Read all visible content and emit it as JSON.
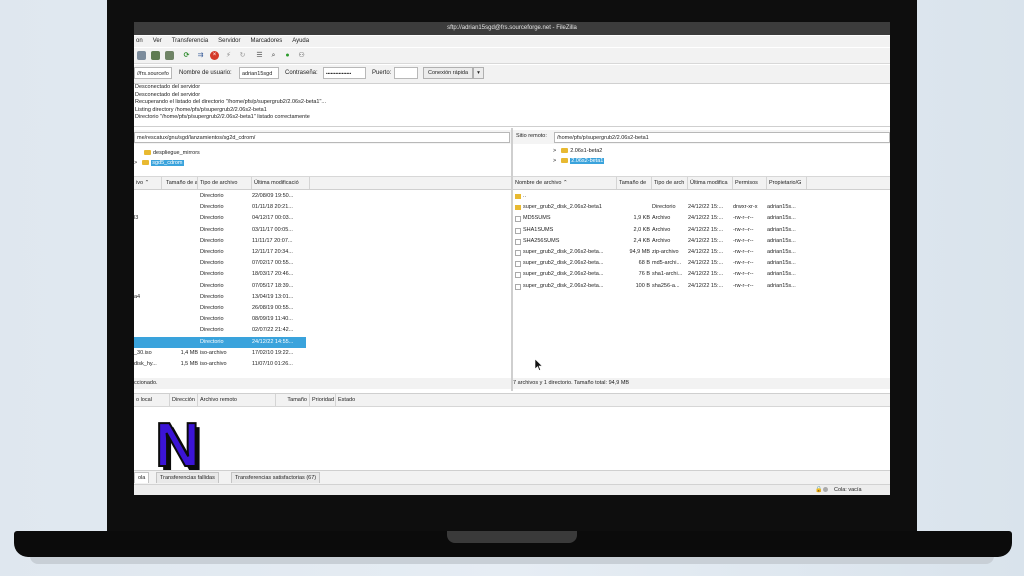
{
  "window": {
    "title": "sftp://adrian15sgd@frs.sourceforge.net - FileZilla"
  },
  "menu": [
    "on",
    "Ver",
    "Transferencia",
    "Servidor",
    "Marcadores",
    "Ayuda"
  ],
  "quickconnect": {
    "host_value": "//frs.sourcefo",
    "user_label": "Nombre de usuario:",
    "user_value": "adrian15sgd",
    "password_label": "Contraseña:",
    "password_value": "••••••••••••••••",
    "port_label": "Puerto:",
    "port_value": "",
    "connect_label": "Conexión rápida",
    "dropdown_icon": "chevron-down"
  },
  "log": [
    "Desconectado del servidor",
    "Desconectado del servidor",
    "Recuperando el listado del directorio \"/home/pfs/p/supergrub2/2.06s2-beta1\"...",
    "Listing directory /home/pfs/p/supergrub2/2.06s2-beta1",
    "Directorio \"/home/pfs/p/supergrub2/2.06s2-beta1\" listado correctamente"
  ],
  "local": {
    "path": "me/rescatux/gnu/sgd/lanzamientos/sg2d_cdrom/",
    "tree": [
      {
        "name": "despliegue_mirrors",
        "expander": ""
      },
      {
        "name": "sgd5_cdrom",
        "expander": ">"
      }
    ],
    "columns": [
      "ivo",
      "Tamaño de a",
      "Tipo de archivo",
      "Última modificació"
    ],
    "rows": [
      {
        "name": "",
        "size": "",
        "type": "Directorio",
        "date": "22/08/09 19:50..."
      },
      {
        "name": "",
        "size": "",
        "type": "Directorio",
        "date": "01/11/18 20:21..."
      },
      {
        "name": "l3",
        "size": "",
        "type": "Directorio",
        "date": "04/12/17 00:03..."
      },
      {
        "name": "",
        "size": "",
        "type": "Directorio",
        "date": "03/11/17 00:05..."
      },
      {
        "name": "",
        "size": "",
        "type": "Directorio",
        "date": "11/11/17 20:07..."
      },
      {
        "name": "",
        "size": "",
        "type": "Directorio",
        "date": "12/11/17 20:34..."
      },
      {
        "name": "",
        "size": "",
        "type": "Directorio",
        "date": "07/02/17 00:55..."
      },
      {
        "name": "",
        "size": "",
        "type": "Directorio",
        "date": "18/03/17 20:46..."
      },
      {
        "name": "",
        "size": "",
        "type": "Directorio",
        "date": "07/05/17 18:39..."
      },
      {
        "name": "a4",
        "size": "",
        "type": "Directorio",
        "date": "13/04/19 13:01..."
      },
      {
        "name": "",
        "size": "",
        "type": "Directorio",
        "date": "26/08/19 00:55..."
      },
      {
        "name": "",
        "size": "",
        "type": "Directorio",
        "date": "08/09/19 11:40..."
      },
      {
        "name": "",
        "size": "",
        "type": "Directorio",
        "date": "02/07/22 21:42..."
      },
      {
        "name": "",
        "size": "",
        "type": "Directorio",
        "date": "24/12/22 14:55..."
      },
      {
        "name": "_30.iso",
        "size": "1,4 MB",
        "type": "iso-archivo",
        "date": "17/02/10 19:22..."
      },
      {
        "name": "disk_hy...",
        "size": "1,5 MB",
        "type": "iso-archivo",
        "date": "11/07/10 01:26..."
      }
    ],
    "status": "ccionado."
  },
  "remote": {
    "path_label": "Sitio remoto:",
    "path": "/home/pfs/p/supergrub2/2.06s2-beta1",
    "tree": [
      {
        "name": "2.06s1-beta2",
        "expander": ">"
      },
      {
        "name": "2.06s2-beta1",
        "expander": ">"
      }
    ],
    "columns": [
      "Nombre de archivo",
      "Tamaño de",
      "Tipo de arch",
      "Última modifica",
      "Permisos",
      "Propietario/G"
    ],
    "rows": [
      {
        "name": "..",
        "size": "",
        "type": "",
        "date": "",
        "perm": "",
        "owner": ""
      },
      {
        "name": "super_grub2_disk_2.06s2-beta1",
        "size": "",
        "type": "Directorio",
        "date": "24/12/22 15:...",
        "perm": "drwxr-xr-x",
        "owner": "adrian15s..."
      },
      {
        "name": "MD5SUMS",
        "size": "1,9 KB",
        "type": "Archivo",
        "date": "24/12/22 15:...",
        "perm": "-rw-r--r--",
        "owner": "adrian15s..."
      },
      {
        "name": "SHA1SUMS",
        "size": "2,0 KB",
        "type": "Archivo",
        "date": "24/12/22 15:...",
        "perm": "-rw-r--r--",
        "owner": "adrian15s..."
      },
      {
        "name": "SHA256SUMS",
        "size": "2,4 KB",
        "type": "Archivo",
        "date": "24/12/22 15:...",
        "perm": "-rw-r--r--",
        "owner": "adrian15s..."
      },
      {
        "name": "super_grub2_disk_2.06s2-beta...",
        "size": "94,9 MB",
        "type": "zip-archivo",
        "date": "24/12/22 15:...",
        "perm": "-rw-r--r--",
        "owner": "adrian15s..."
      },
      {
        "name": "super_grub2_disk_2.06s2-beta...",
        "size": "68 B",
        "type": "md5-archi...",
        "date": "24/12/22 15:...",
        "perm": "-rw-r--r--",
        "owner": "adrian15s..."
      },
      {
        "name": "super_grub2_disk_2.06s2-beta...",
        "size": "76 B",
        "type": "sha1-archi...",
        "date": "24/12/22 15:...",
        "perm": "-rw-r--r--",
        "owner": "adrian15s..."
      },
      {
        "name": "super_grub2_disk_2.06s2-beta...",
        "size": "100 B",
        "type": "sha256-a...",
        "date": "24/12/22 15:...",
        "perm": "-rw-r--r--",
        "owner": "adrian15s..."
      }
    ],
    "status": "7 archivos y 1 directorio. Tamaño total: 94,9 MB"
  },
  "queue": {
    "columns": [
      "o local",
      "Dirección",
      "Archivo remoto",
      "Tamaño",
      "Prioridad",
      "Estado"
    ],
    "tabs": [
      "ola",
      "Transferencias fallidas",
      "Transferencias satisfactorias (67)"
    ],
    "status_text": "Cola: vacía"
  },
  "overlay": {
    "letter": "N",
    "fill": "#3b14d6",
    "shadow": "#0b0b0b"
  }
}
